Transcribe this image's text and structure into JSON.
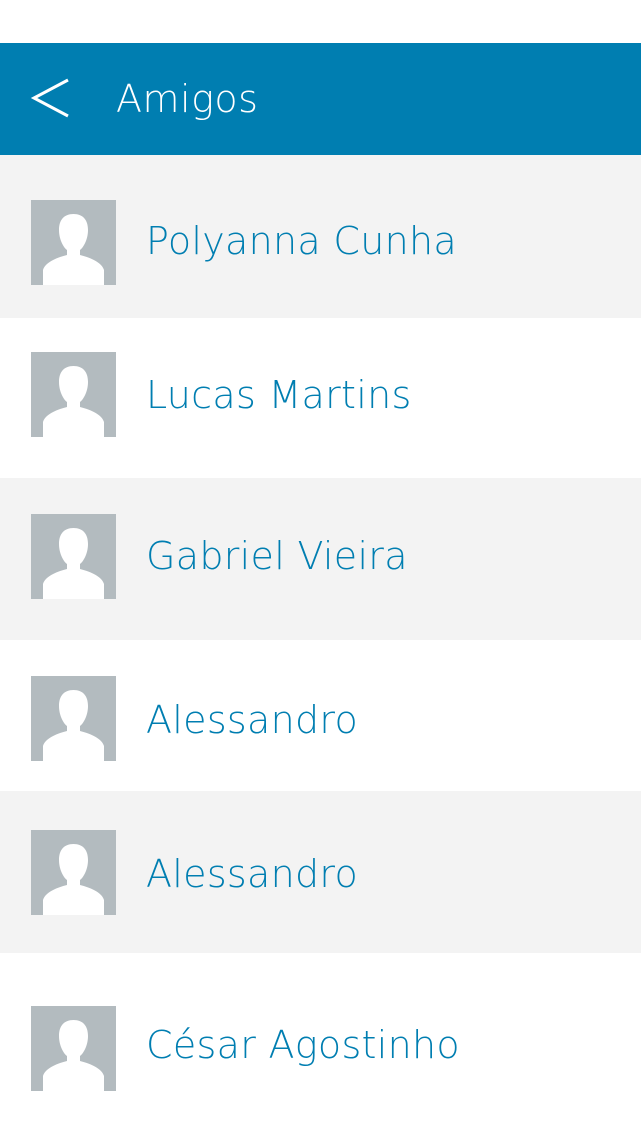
{
  "theme": {
    "accent": "#007eb1",
    "row_alt_bg": "#f3f3f3",
    "avatar_bg": "#b3bbbf"
  },
  "header": {
    "title": "Amigos",
    "back_icon": "chevron-left-icon"
  },
  "friends": [
    {
      "name": "Polyanna Cunha",
      "avatar_icon": "user-silhouette-icon"
    },
    {
      "name": "Lucas Martins",
      "avatar_icon": "user-silhouette-icon"
    },
    {
      "name": "Gabriel Vieira",
      "avatar_icon": "user-silhouette-icon"
    },
    {
      "name": "Alessandro",
      "avatar_icon": "user-silhouette-icon"
    },
    {
      "name": "Alessandro",
      "avatar_icon": "user-silhouette-icon"
    },
    {
      "name": "César Agostinho",
      "avatar_icon": "user-silhouette-icon"
    }
  ]
}
